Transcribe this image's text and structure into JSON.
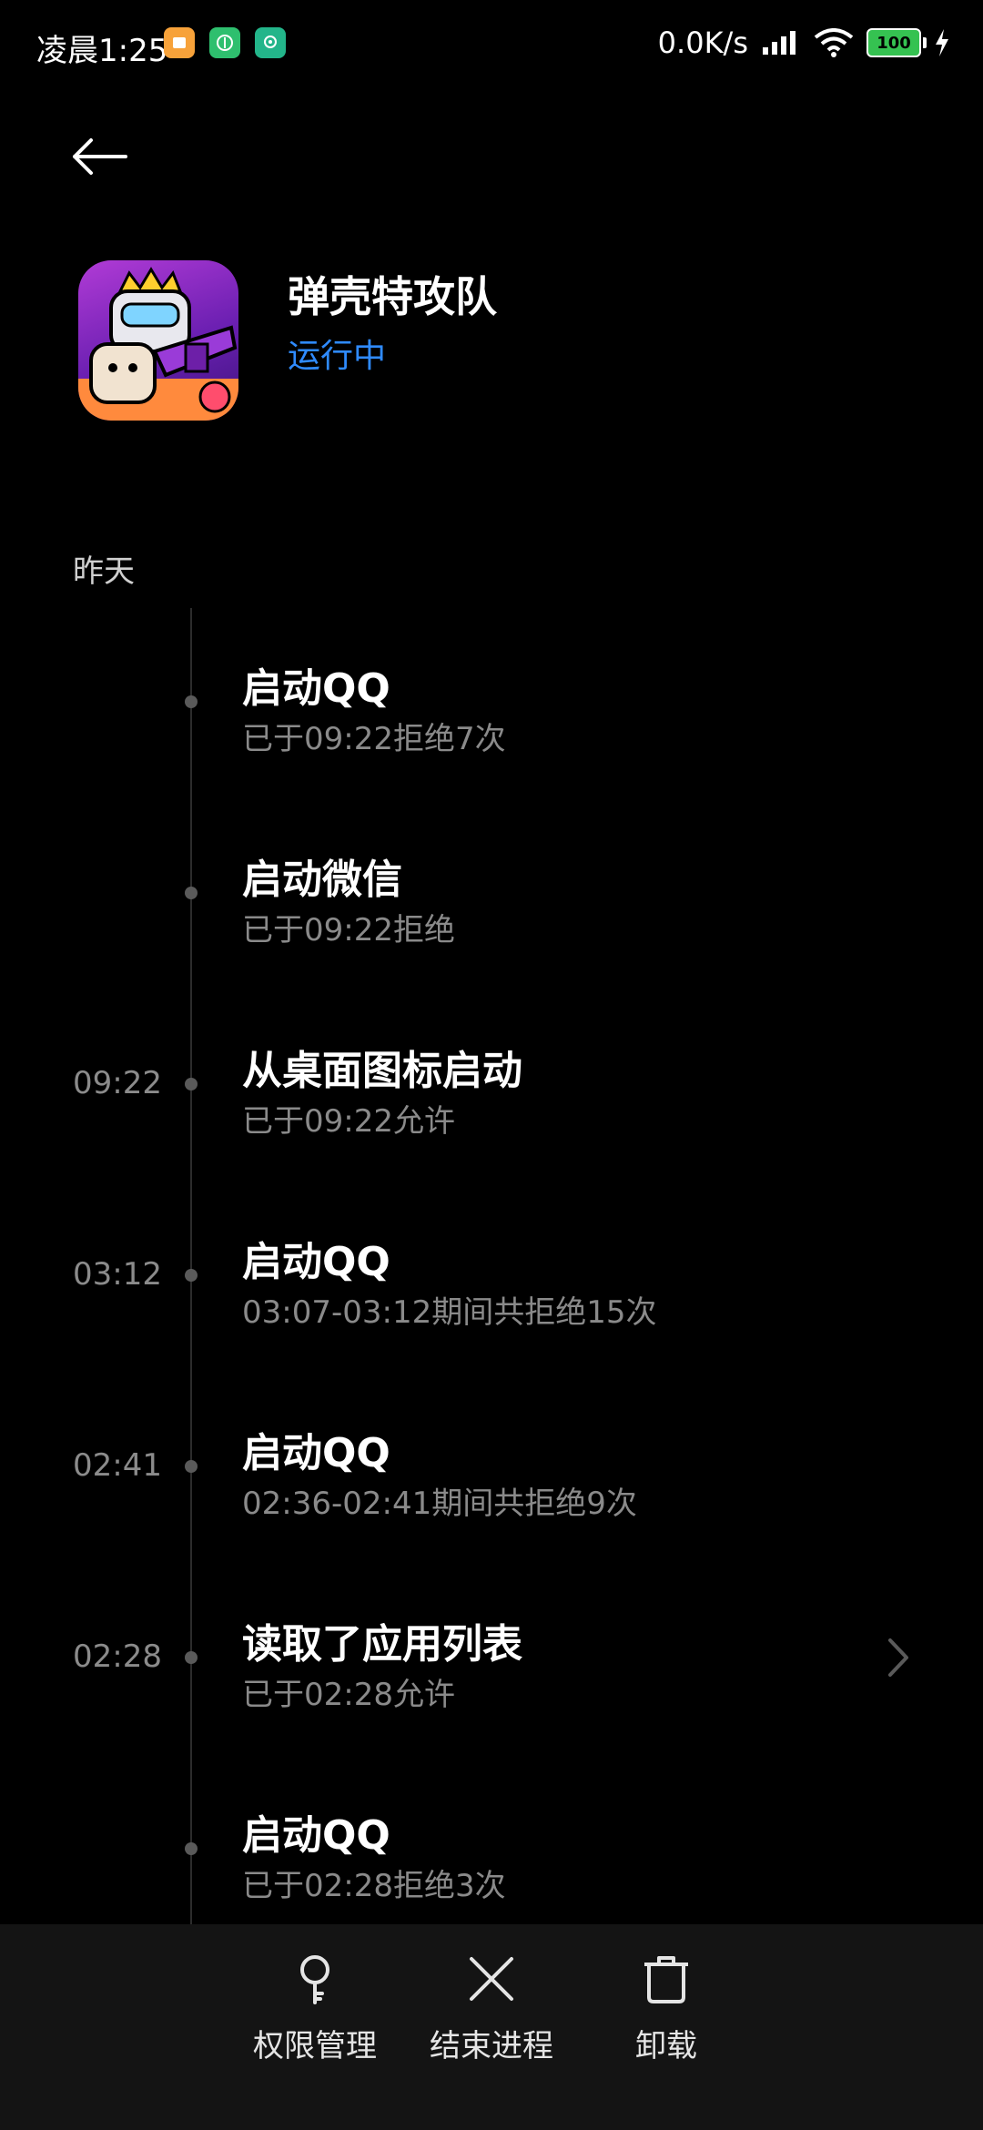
{
  "status_bar": {
    "time": "凌晨1:25",
    "network_speed": "0.0K/s",
    "battery": "100"
  },
  "app": {
    "name": "弹壳特攻队",
    "status": "运行中"
  },
  "section_label": "昨天",
  "timeline": [
    {
      "time": "",
      "title": "启动QQ",
      "subtitle": "已于09:22拒绝7次"
    },
    {
      "time": "",
      "title": "启动微信",
      "subtitle": "已于09:22拒绝"
    },
    {
      "time": "09:22",
      "title": "从桌面图标启动",
      "subtitle": "已于09:22允许"
    },
    {
      "time": "03:12",
      "title": "启动QQ",
      "subtitle": "03:07-03:12期间共拒绝15次"
    },
    {
      "time": "02:41",
      "title": "启动QQ",
      "subtitle": "02:36-02:41期间共拒绝9次"
    },
    {
      "time": "02:28",
      "title": "读取了应用列表",
      "subtitle": "已于02:28允许"
    },
    {
      "time": "",
      "title": "启动QQ",
      "subtitle": "已于02:28拒绝3次"
    }
  ],
  "bottom_bar": {
    "permissions": "权限管理",
    "end_process": "结束进程",
    "uninstall": "卸载"
  },
  "colors": {
    "accent": "#2f8bff",
    "background": "#000000"
  }
}
